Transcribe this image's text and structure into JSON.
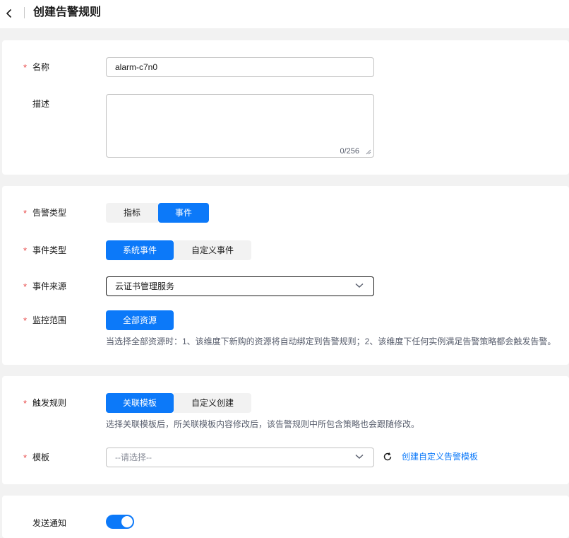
{
  "header": {
    "title": "创建告警规则"
  },
  "basic": {
    "name_label": "名称",
    "name_value": "alarm-c7n0",
    "desc_label": "描述",
    "desc_counter": "0/256"
  },
  "alarm": {
    "type_label": "告警类型",
    "type_options": [
      "指标",
      "事件"
    ],
    "type_selected": "事件",
    "event_type_label": "事件类型",
    "event_type_options": [
      "系统事件",
      "自定义事件"
    ],
    "event_type_selected": "系统事件",
    "event_source_label": "事件来源",
    "event_source_value": "云证书管理服务",
    "scope_label": "监控范围",
    "scope_button": "全部资源",
    "scope_hint": "当选择全部资源时：1、该维度下新购的资源将自动绑定到告警规则；2、该维度下任何实例满足告警策略都会触发告警。"
  },
  "trigger": {
    "rule_label": "触发规则",
    "rule_options": [
      "关联模板",
      "自定义创建"
    ],
    "rule_selected": "关联模板",
    "rule_hint": "选择关联模板后，所关联模板内容修改后，该告警规则中所包含策略也会跟随修改。",
    "template_label": "模板",
    "template_placeholder": "--请选择--",
    "create_template_link": "创建自定义告警模板"
  },
  "notify": {
    "label": "发送通知",
    "enabled": true
  },
  "colors": {
    "primary": "#0c79f9",
    "required": "#e84b4b",
    "background": "#f2f2f2"
  }
}
